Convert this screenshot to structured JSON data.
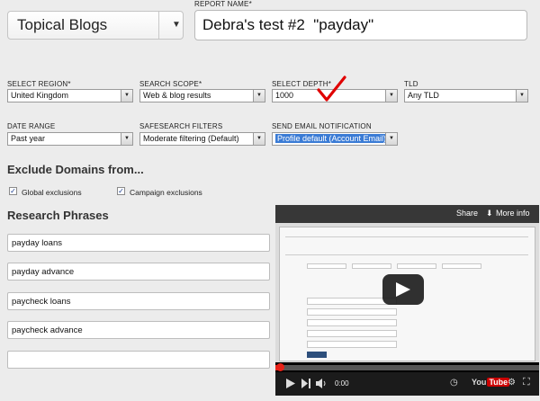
{
  "report": {
    "type_select_value": "Topical Blogs",
    "report_name_label": "REPORT NAME*",
    "report_name_value": "Debra's test #2  \"payday\""
  },
  "filters": {
    "region": {
      "label": "SELECT REGION*",
      "value": "United Kingdom"
    },
    "scope": {
      "label": "SEARCH SCOPE*",
      "value": "Web & blog results"
    },
    "depth": {
      "label": "SELECT DEPTH*",
      "value": "1000"
    },
    "tld": {
      "label": "TLD",
      "value": "Any TLD"
    },
    "date_range": {
      "label": "DATE RANGE",
      "value": "Past year"
    },
    "safesearch": {
      "label": "SAFESEARCH FILTERS",
      "value": "Moderate filtering (Default)"
    },
    "email": {
      "label": "SEND EMAIL NOTIFICATION",
      "value": "Profile default (Account Email)"
    }
  },
  "exclude": {
    "title": "Exclude Domains from...",
    "global_label": "Global exclusions",
    "campaign_label": "Campaign exclusions",
    "global_checked": true,
    "campaign_checked": true
  },
  "phrases": {
    "title": "Research Phrases",
    "items": [
      "payday loans",
      "payday advance",
      "paycheck loans",
      "paycheck advance",
      ""
    ]
  },
  "video": {
    "share_label": "Share",
    "more_info_label": "More info",
    "time": "0:00",
    "brand": "You",
    "brand_tube": "Tube",
    "progress_fraction": 0.01
  },
  "colors": {
    "accent_selected": "#3a7bd5",
    "checkmark_red": "#e00000",
    "youtube_red": "#e62117"
  },
  "icons": [
    "dropdown-arrow-icon",
    "checkmark-annotation-icon",
    "play-icon",
    "volume-icon",
    "settings-icon",
    "fullscreen-icon",
    "clock-icon",
    "next-icon"
  ]
}
